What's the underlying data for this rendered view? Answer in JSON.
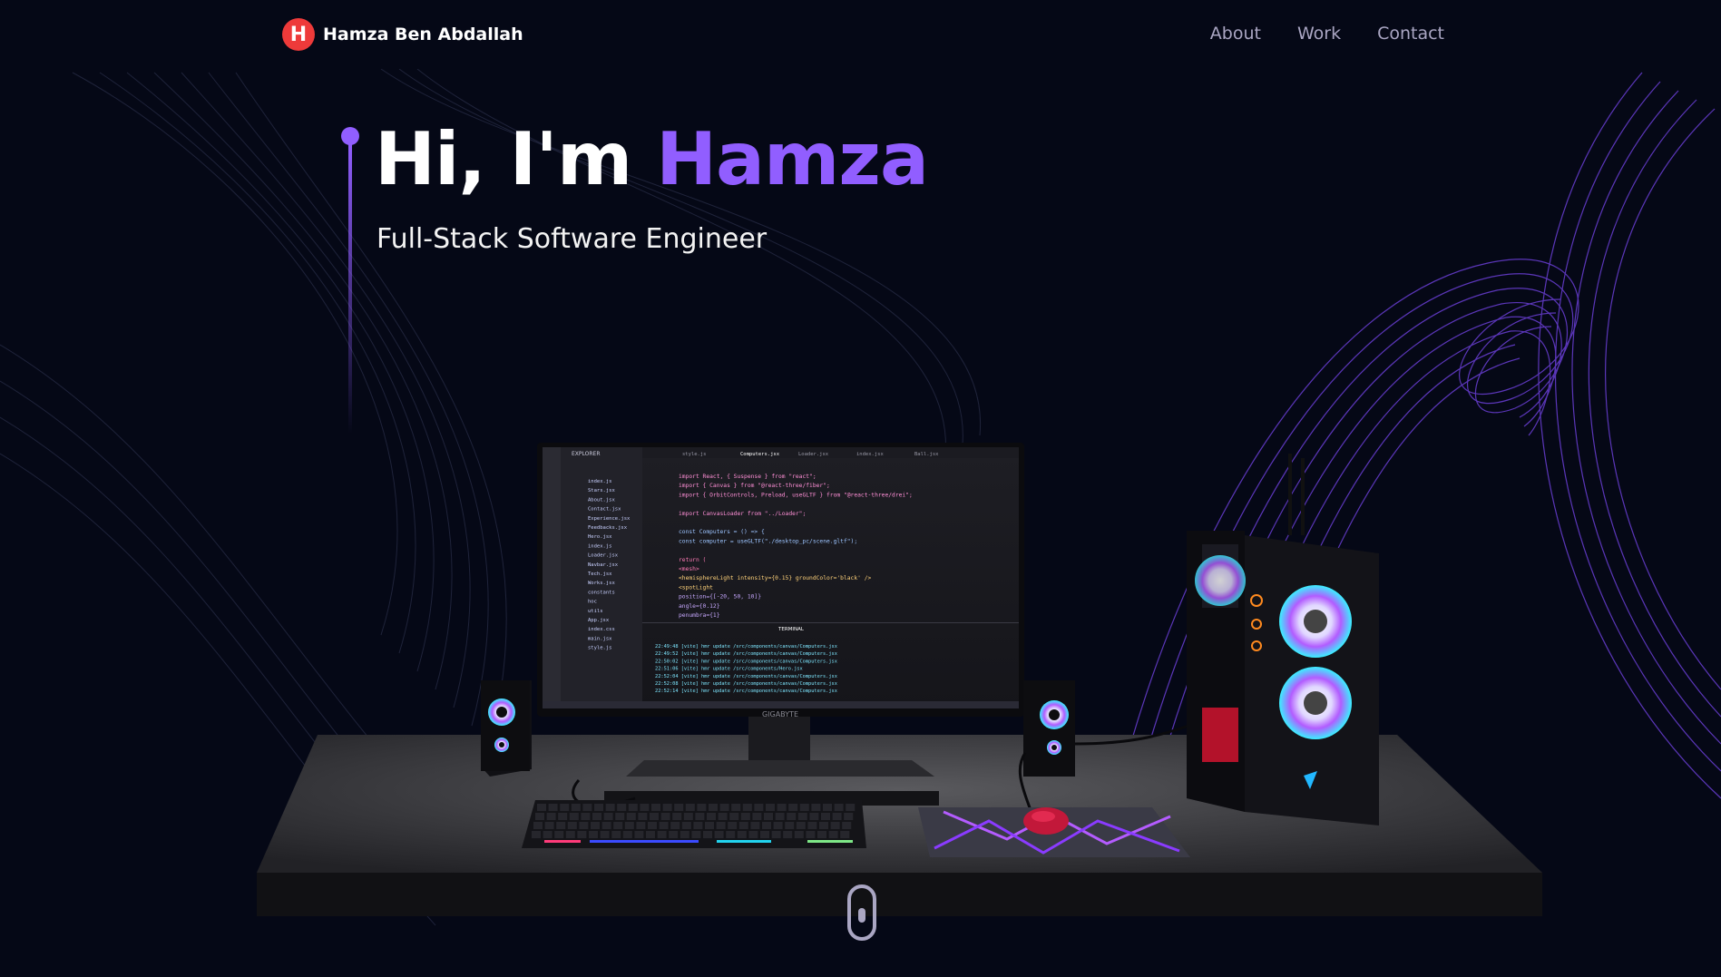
{
  "nav": {
    "logo_letter": "H",
    "brand_name": "Hamza Ben Abdallah",
    "links": [
      "About",
      "Work",
      "Contact"
    ]
  },
  "hero": {
    "greeting": "Hi, I'm ",
    "name": "Hamza",
    "subtitle": "Full-Stack Software Engineer"
  },
  "scene": {
    "monitor_brand": "GIGABYTE",
    "editor_tabs": [
      "style.js",
      "Computers.jsx",
      "Loader.jsx",
      "index.jsx",
      "Ball.jsx"
    ],
    "explorer_label": "EXPLORER",
    "terminal_label": "TERMINAL",
    "code_lines": [
      "import React, { Suspense } from \"react\";",
      "import { Canvas } from \"@react-three/fiber\";",
      "import { OrbitControls, Preload, useGLTF } from \"@react-three/drei\";",
      "",
      "import CanvasLoader from \"../Loader\";",
      "",
      "const Computers = () => {",
      "  const computer = useGLTF(\"./desktop_pc/scene.gltf\");",
      "",
      "  return (",
      "    <mesh>",
      "      <hemisphereLight intensity={0.15} groundColor='black' />",
      "      <spotLight",
      "        position={[-20, 50, 10]}",
      "        angle={0.12}",
      "        penumbra={1}"
    ],
    "terminal_lines": [
      "22:49:48 [vite] hmr update /src/components/canvas/Computers.jsx",
      "22:49:52 [vite] hmr update /src/components/canvas/Computers.jsx",
      "22:50:02 [vite] hmr update /src/components/canvas/Computers.jsx",
      "22:51:06 [vite] hmr update /src/components/Hero.jsx",
      "22:52:04 [vite] hmr update /src/components/canvas/Computers.jsx",
      "22:52:08 [vite] hmr update /src/components/canvas/Computers.jsx",
      "22:52:14 [vite] hmr update /src/components/canvas/Computers.jsx"
    ],
    "files": [
      "index.js",
      "Stars.jsx",
      "About.jsx",
      "Contact.jsx",
      "Experience.jsx",
      "Feedbacks.jsx",
      "Hero.jsx",
      "index.js",
      "Loader.jsx",
      "Navbar.jsx",
      "Tech.jsx",
      "Works.jsx",
      "constants",
      "hoc",
      "utils",
      "App.jsx",
      "index.css",
      "main.jsx",
      "style.js"
    ]
  },
  "colors": {
    "background": "#050816",
    "accent": "#915eff",
    "logo": "#ee3a3a",
    "nav_text": "#aaa6c3"
  },
  "icons": {
    "scroll": "mouse-scroll-icon"
  }
}
